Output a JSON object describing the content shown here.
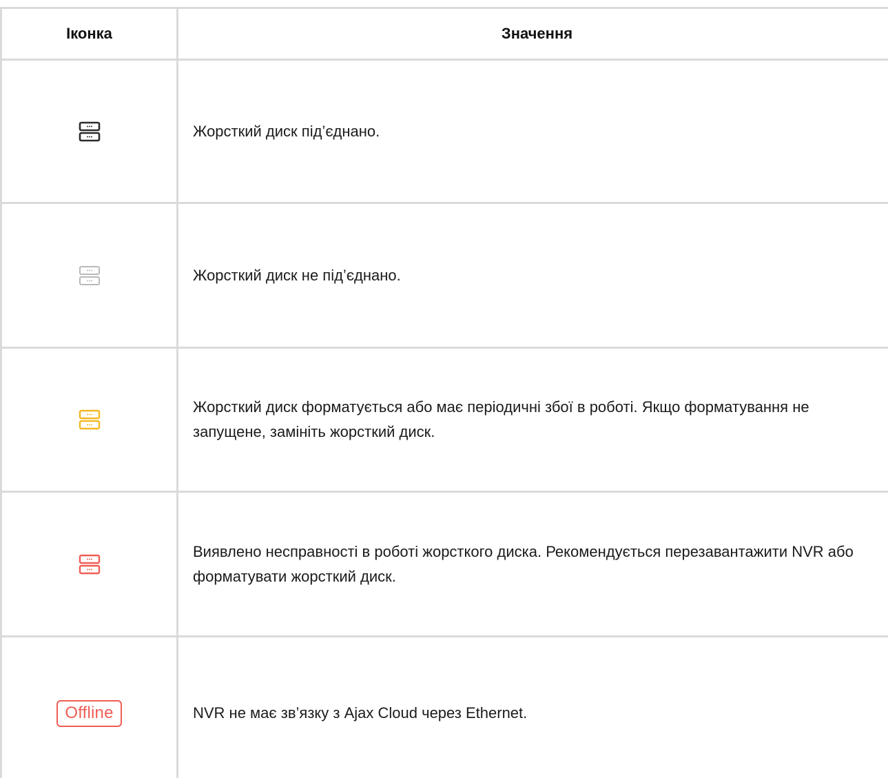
{
  "table": {
    "headers": {
      "icon": "Іконка",
      "meaning": "Значення"
    },
    "rows": [
      {
        "icon": "hdd-connected-icon",
        "icon_color": "#2b2b2b",
        "text": "Жорсткий диск під’єднано."
      },
      {
        "icon": "hdd-disconnected-icon",
        "icon_color": "#b9b9b9",
        "text": "Жорсткий диск не під’єднано."
      },
      {
        "icon": "hdd-formatting-icon",
        "icon_color": "#f5b822",
        "text": "Жорсткий диск форматується або має періодичні збої в роботі. Якщо форматування не запущене, замініть жорсткий диск."
      },
      {
        "icon": "hdd-error-icon",
        "icon_color": "#ef5d55",
        "text": "Виявлено несправності в роботі жорсткого диска. Рекомендується перезавантажити NVR або форматувати жорсткий диск."
      },
      {
        "icon": "offline-badge",
        "badge_label": "Offline",
        "icon_color": "#ef5d55",
        "text": "NVR не має зв’язку з Ajax Cloud через Ethernet."
      }
    ]
  }
}
